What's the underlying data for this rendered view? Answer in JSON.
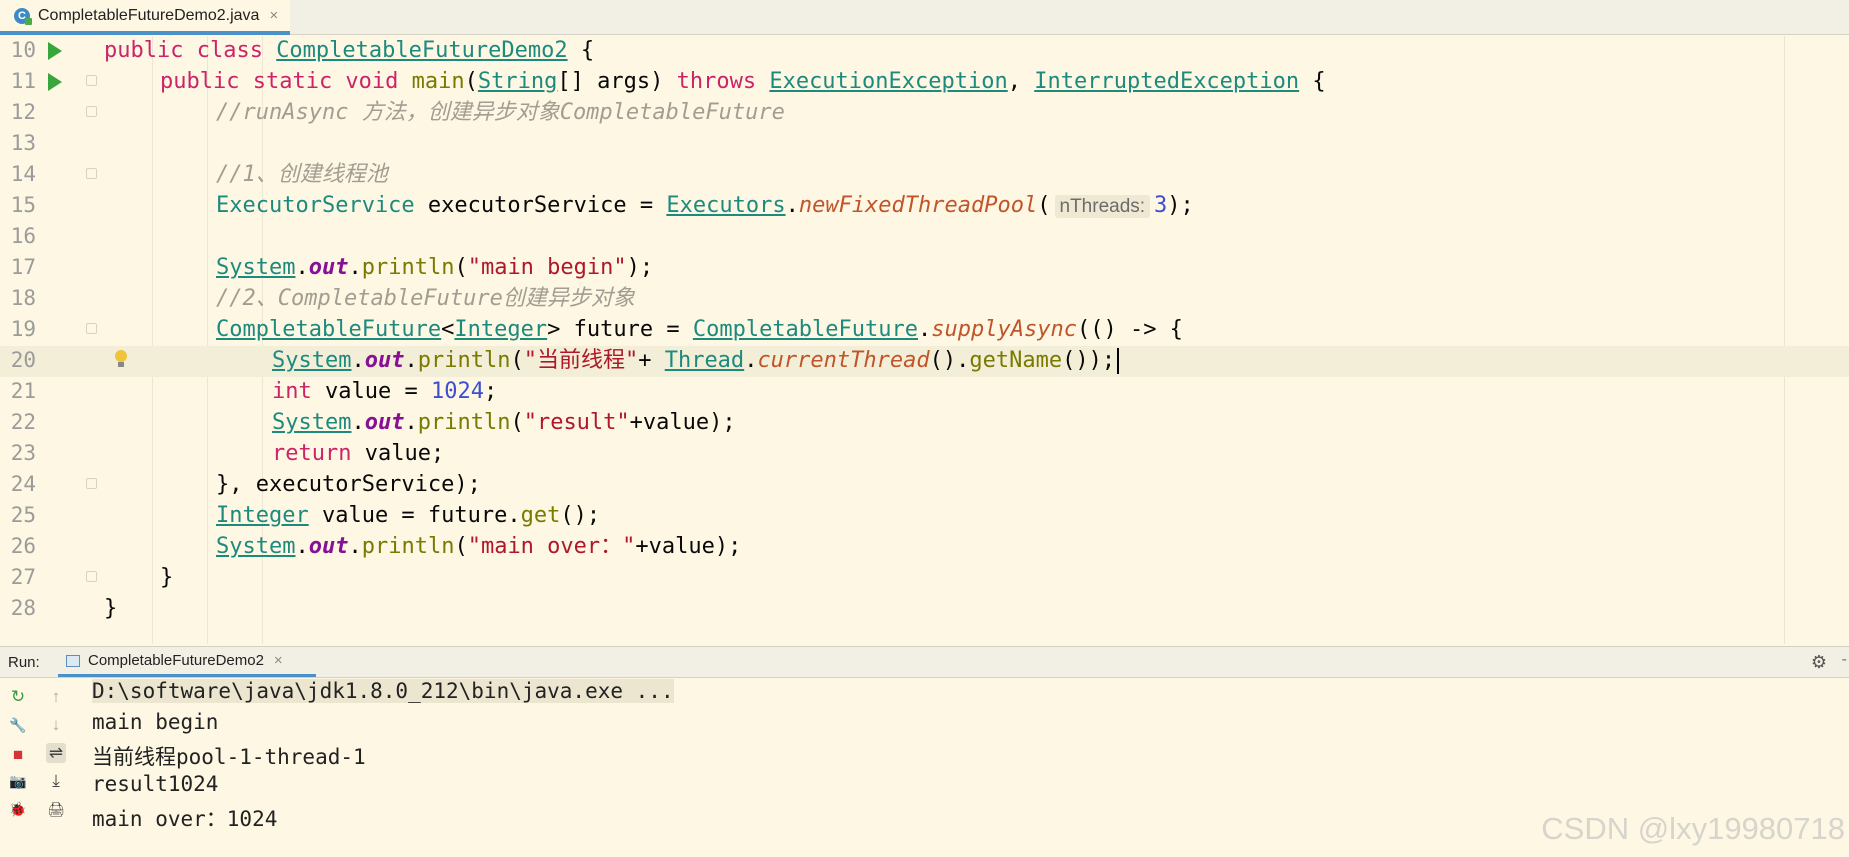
{
  "tab": {
    "icon_label": "C",
    "filename": "CompletableFutureDemo2.java",
    "close": "×"
  },
  "editor": {
    "lines": [
      {
        "n": "10"
      },
      {
        "n": "11"
      },
      {
        "n": "12"
      },
      {
        "n": "13"
      },
      {
        "n": "14"
      },
      {
        "n": "15"
      },
      {
        "n": "16"
      },
      {
        "n": "17"
      },
      {
        "n": "18"
      },
      {
        "n": "19"
      },
      {
        "n": "20"
      },
      {
        "n": "21"
      },
      {
        "n": "22"
      },
      {
        "n": "23"
      },
      {
        "n": "24"
      },
      {
        "n": "25"
      },
      {
        "n": "26"
      },
      {
        "n": "27"
      },
      {
        "n": "28"
      }
    ],
    "code": {
      "l10": [
        "public class ",
        "CompletableFutureDemo2",
        " {"
      ],
      "l11": [
        "public static void ",
        "main",
        "(",
        "String",
        "[] args) ",
        "throws ",
        "ExecutionException",
        ", ",
        "InterruptedException",
        " {"
      ],
      "l12": "//runAsync 方法，创建异步对象CompletableFuture",
      "l14": "//1、创建线程池",
      "l15": [
        "ExecutorService",
        " executorService = ",
        "Executors",
        ".",
        "newFixedThreadPool",
        "(",
        "nThreads:",
        "3",
        ");"
      ],
      "l17": [
        "System",
        ".",
        "out",
        ".",
        "println",
        "(",
        "\"main begin\"",
        ");"
      ],
      "l18": "//2、CompletableFuture创建异步对象",
      "l19": [
        "CompletableFuture",
        "<",
        "Integer",
        "> future = ",
        "CompletableFuture",
        ".",
        "supplyAsync",
        "(() -> {"
      ],
      "l20": [
        "System",
        ".",
        "out",
        ".",
        "println",
        "(",
        "\"当前线程\"",
        "+ ",
        "Thread",
        ".",
        "currentThread",
        "().",
        "getName",
        "());"
      ],
      "l21": [
        "int ",
        "value = ",
        "1024",
        ";"
      ],
      "l22": [
        "System",
        ".",
        "out",
        ".",
        "println",
        "(",
        "\"result\"",
        "+value);"
      ],
      "l23": [
        "return ",
        "value;"
      ],
      "l24": "}, executorService);",
      "l25": [
        "Integer",
        " value = future.",
        "get",
        "();"
      ],
      "l26": [
        "System",
        ".",
        "out",
        ".",
        "println",
        "(",
        "\"main over：\"",
        "+value);"
      ],
      "l27": "}",
      "l28": "}"
    }
  },
  "run": {
    "label": "Run:",
    "tab": "CompletableFutureDemo2",
    "close": "×",
    "gear": "⚙",
    "dash": "-",
    "output": [
      "D:\\software\\java\\jdk1.8.0_212\\bin\\java.exe ...",
      "main begin",
      "当前线程pool-1-thread-1",
      "result1024",
      "main over：1024"
    ],
    "tools_left": [
      "↻",
      "🔧",
      "■",
      "📷",
      "🐞"
    ],
    "tools_right": [
      "↑",
      "↓",
      "⇌",
      "⤓",
      "🖨"
    ]
  },
  "watermark": "CSDN @lxy19980718"
}
